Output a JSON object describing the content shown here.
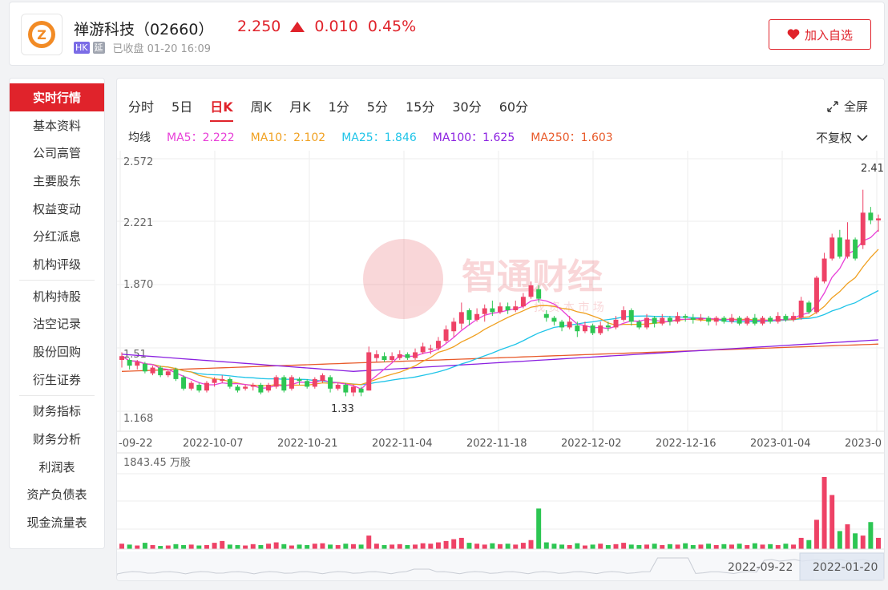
{
  "header": {
    "logo_letter": "Z",
    "stock_name": "禅游科技（02660）",
    "price": "2.250",
    "change": "0.010",
    "change_pct": "0.45%",
    "tag_hk": "HK",
    "tag_delay": "延",
    "status": "已收盘 01-20 16:09",
    "add_button": "加入自选",
    "up_color": "#e0232b"
  },
  "sidebar": {
    "groups": [
      [
        "实时行情",
        "基本资料",
        "公司高管",
        "主要股东",
        "权益变动",
        "分红派息",
        "机构评级"
      ],
      [
        "机构持股",
        "沽空记录",
        "股份回购",
        "衍生证券"
      ],
      [
        "财务指标",
        "财务分析",
        "利润表",
        "资产负债表",
        "现金流量表"
      ]
    ],
    "active": "实时行情"
  },
  "tabs": [
    "分时",
    "5日",
    "日K",
    "周K",
    "月K",
    "1分",
    "5分",
    "15分",
    "30分",
    "60分"
  ],
  "active_tab": "日K",
  "fullscreen_label": "全屏",
  "adjust_label": "不复权",
  "ma_row": {
    "label": "均线",
    "items": [
      {
        "text": "MA5：2.222",
        "color": "#e83fd8"
      },
      {
        "text": "MA10：2.102",
        "color": "#f0a020"
      },
      {
        "text": "MA25：1.846",
        "color": "#1fc4e8"
      },
      {
        "text": "MA100：1.625",
        "color": "#8a1fe0"
      },
      {
        "text": "MA250：1.603",
        "color": "#e85a2a"
      }
    ]
  },
  "chart_data": {
    "type": "candlestick",
    "y_ticks": [
      "2.572",
      "2.221",
      "1.870",
      "1.51",
      "1.168"
    ],
    "ylim": [
      1.168,
      2.572
    ],
    "x_ticks": [
      "-09-22",
      "2022-10-07",
      "2022-10-21",
      "2022-11-04",
      "2022-11-18",
      "2022-12-02",
      "2022-12-16",
      "2023-01-04",
      "2023-0"
    ],
    "high_label": "2.41",
    "low_label": "1.33",
    "volume_label": "1843.45 万股",
    "range_labels": [
      "2022-09-22",
      "2022-01-20"
    ],
    "watermark": "智通财经",
    "watermark_sub": "找 资 本 市 场",
    "up_color": "#ee4266",
    "down_color": "#2dc653",
    "candles": [
      [
        1.52,
        1.54,
        1.56,
        1.48
      ],
      [
        1.52,
        1.49,
        1.53,
        1.47
      ],
      [
        1.49,
        1.51,
        1.52,
        1.47
      ],
      [
        1.5,
        1.46,
        1.51,
        1.45
      ],
      [
        1.45,
        1.48,
        1.49,
        1.44
      ],
      [
        1.48,
        1.44,
        1.49,
        1.43
      ],
      [
        1.44,
        1.46,
        1.47,
        1.43
      ],
      [
        1.47,
        1.42,
        1.48,
        1.41
      ],
      [
        1.43,
        1.37,
        1.44,
        1.36
      ],
      [
        1.37,
        1.4,
        1.41,
        1.36
      ],
      [
        1.39,
        1.36,
        1.4,
        1.35
      ],
      [
        1.36,
        1.4,
        1.41,
        1.35
      ],
      [
        1.4,
        1.42,
        1.43,
        1.38
      ],
      [
        1.41,
        1.42,
        1.44,
        1.4
      ],
      [
        1.42,
        1.38,
        1.43,
        1.37
      ],
      [
        1.38,
        1.36,
        1.39,
        1.35
      ],
      [
        1.37,
        1.38,
        1.39,
        1.36
      ],
      [
        1.38,
        1.39,
        1.4,
        1.36
      ],
      [
        1.39,
        1.35,
        1.4,
        1.34
      ],
      [
        1.36,
        1.39,
        1.4,
        1.35
      ],
      [
        1.38,
        1.43,
        1.44,
        1.37
      ],
      [
        1.43,
        1.36,
        1.44,
        1.35
      ],
      [
        1.37,
        1.43,
        1.44,
        1.36
      ],
      [
        1.42,
        1.41,
        1.43,
        1.39
      ],
      [
        1.41,
        1.38,
        1.42,
        1.37
      ],
      [
        1.38,
        1.42,
        1.43,
        1.37
      ],
      [
        1.41,
        1.44,
        1.45,
        1.4
      ],
      [
        1.43,
        1.37,
        1.44,
        1.35
      ],
      [
        1.37,
        1.39,
        1.4,
        1.36
      ],
      [
        1.39,
        1.35,
        1.4,
        1.33
      ],
      [
        1.35,
        1.38,
        1.39,
        1.33
      ],
      [
        1.37,
        1.35,
        1.38,
        1.33
      ],
      [
        1.36,
        1.56,
        1.59,
        1.36
      ],
      [
        1.53,
        1.55,
        1.57,
        1.51
      ],
      [
        1.54,
        1.52,
        1.56,
        1.51
      ],
      [
        1.52,
        1.54,
        1.56,
        1.51
      ],
      [
        1.53,
        1.55,
        1.57,
        1.52
      ],
      [
        1.55,
        1.53,
        1.56,
        1.52
      ],
      [
        1.53,
        1.56,
        1.58,
        1.52
      ],
      [
        1.56,
        1.59,
        1.61,
        1.55
      ],
      [
        1.58,
        1.58,
        1.6,
        1.55
      ],
      [
        1.58,
        1.62,
        1.64,
        1.57
      ],
      [
        1.62,
        1.68,
        1.7,
        1.61
      ],
      [
        1.67,
        1.72,
        1.74,
        1.64
      ],
      [
        1.71,
        1.77,
        1.82,
        1.68
      ],
      [
        1.78,
        1.73,
        1.79,
        1.7
      ],
      [
        1.73,
        1.76,
        1.79,
        1.72
      ],
      [
        1.76,
        1.79,
        1.81,
        1.72
      ],
      [
        1.79,
        1.77,
        1.83,
        1.75
      ],
      [
        1.77,
        1.8,
        1.82,
        1.76
      ],
      [
        1.8,
        1.78,
        1.82,
        1.76
      ],
      [
        1.78,
        1.8,
        1.83,
        1.77
      ],
      [
        1.8,
        1.85,
        1.87,
        1.79
      ],
      [
        1.85,
        1.91,
        1.93,
        1.84
      ],
      [
        1.89,
        1.84,
        1.91,
        1.82
      ],
      [
        1.76,
        1.74,
        1.78,
        1.72
      ],
      [
        1.74,
        1.72,
        1.75,
        1.7
      ],
      [
        1.72,
        1.69,
        1.73,
        1.67
      ],
      [
        1.69,
        1.72,
        1.75,
        1.68
      ],
      [
        1.7,
        1.67,
        1.72,
        1.64
      ],
      [
        1.67,
        1.7,
        1.72,
        1.66
      ],
      [
        1.7,
        1.66,
        1.71,
        1.65
      ],
      [
        1.66,
        1.7,
        1.72,
        1.65
      ],
      [
        1.7,
        1.69,
        1.72,
        1.67
      ],
      [
        1.69,
        1.73,
        1.75,
        1.68
      ],
      [
        1.73,
        1.78,
        1.8,
        1.72
      ],
      [
        1.78,
        1.72,
        1.79,
        1.7
      ],
      [
        1.72,
        1.69,
        1.73,
        1.68
      ],
      [
        1.69,
        1.74,
        1.76,
        1.68
      ],
      [
        1.74,
        1.71,
        1.75,
        1.69
      ],
      [
        1.71,
        1.74,
        1.76,
        1.7
      ],
      [
        1.74,
        1.72,
        1.75,
        1.7
      ],
      [
        1.72,
        1.75,
        1.77,
        1.71
      ],
      [
        1.75,
        1.74,
        1.76,
        1.72
      ],
      [
        1.74,
        1.73,
        1.76,
        1.71
      ],
      [
        1.73,
        1.74,
        1.76,
        1.72
      ],
      [
        1.74,
        1.72,
        1.75,
        1.7
      ],
      [
        1.72,
        1.74,
        1.75,
        1.7
      ],
      [
        1.74,
        1.72,
        1.75,
        1.71
      ],
      [
        1.72,
        1.74,
        1.76,
        1.71
      ],
      [
        1.74,
        1.71,
        1.75,
        1.7
      ],
      [
        1.71,
        1.74,
        1.75,
        1.7
      ],
      [
        1.74,
        1.71,
        1.76,
        1.7
      ],
      [
        1.71,
        1.74,
        1.75,
        1.7
      ],
      [
        1.74,
        1.72,
        1.75,
        1.71
      ],
      [
        1.72,
        1.75,
        1.77,
        1.71
      ],
      [
        1.75,
        1.73,
        1.76,
        1.72
      ],
      [
        1.73,
        1.75,
        1.77,
        1.72
      ],
      [
        1.74,
        1.83,
        1.85,
        1.73
      ],
      [
        1.82,
        1.77,
        1.83,
        1.76
      ],
      [
        1.77,
        1.95,
        1.96,
        1.76
      ],
      [
        1.93,
        2.05,
        2.08,
        1.92
      ],
      [
        2.05,
        2.16,
        2.18,
        2.04
      ],
      [
        2.16,
        2.06,
        2.2,
        2.05
      ],
      [
        2.06,
        2.15,
        2.24,
        2.05
      ],
      [
        2.15,
        2.05,
        2.16,
        2.04
      ],
      [
        2.12,
        2.29,
        2.41,
        2.1
      ],
      [
        2.29,
        2.25,
        2.32,
        2.23
      ],
      [
        2.25,
        2.26,
        2.28,
        2.19
      ]
    ],
    "volumes": [
      12,
      10,
      8,
      14,
      9,
      7,
      8,
      11,
      9,
      10,
      8,
      9,
      14,
      18,
      10,
      9,
      8,
      11,
      9,
      12,
      15,
      11,
      8,
      10,
      9,
      12,
      13,
      10,
      9,
      12,
      11,
      10,
      30,
      12,
      9,
      10,
      11,
      9,
      10,
      13,
      12,
      15,
      18,
      22,
      25,
      14,
      12,
      10,
      13,
      11,
      12,
      10,
      14,
      20,
      90,
      15,
      12,
      10,
      9,
      13,
      8,
      10,
      12,
      9,
      11,
      14,
      10,
      9,
      10,
      12,
      9,
      11,
      10,
      13,
      9,
      10,
      12,
      9,
      11,
      10,
      12,
      9,
      13,
      10,
      11,
      9,
      12,
      10,
      25,
      20,
      65,
      160,
      120,
      40,
      55,
      35,
      30,
      60,
      25,
      20
    ]
  }
}
